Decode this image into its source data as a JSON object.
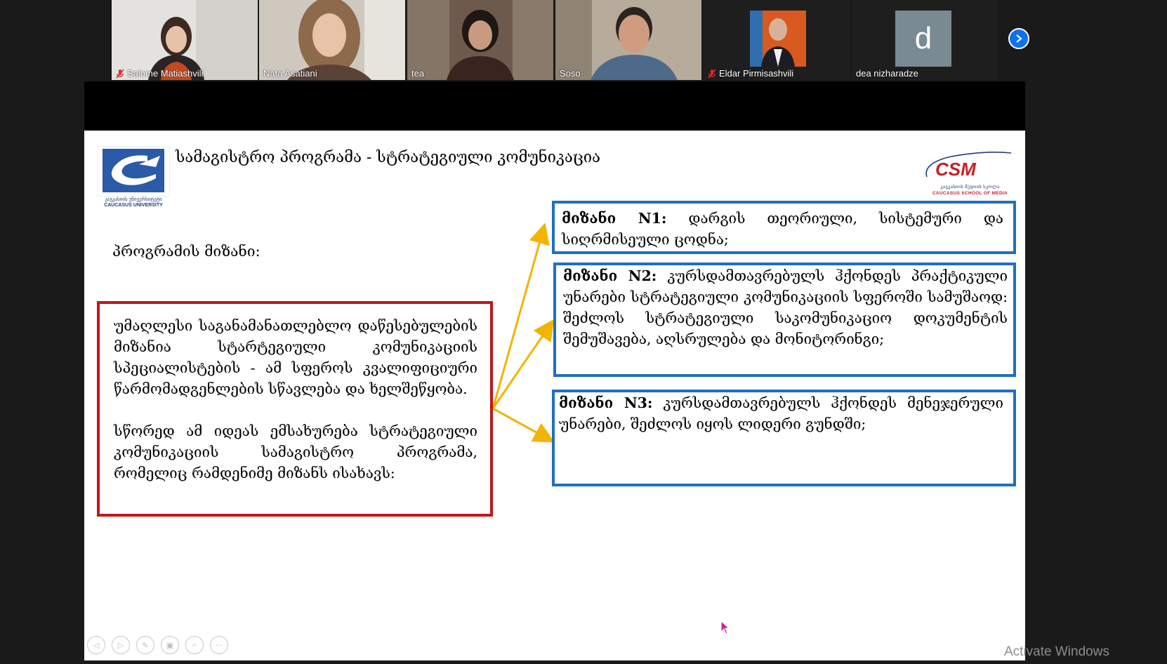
{
  "participants": [
    {
      "name": "Salome Matiashvili",
      "muted": true,
      "bg": "#d9d9d6"
    },
    {
      "name": "Nata Asatiani",
      "muted": false,
      "bg": "#c9c1b7",
      "active_speaker": true
    },
    {
      "name": "tea",
      "muted": false,
      "bg": "#5a4a40"
    },
    {
      "name": "Soso",
      "muted": false,
      "bg": "#a89c8c"
    },
    {
      "name": "Eldar Pirmisashvili",
      "muted": true,
      "bg": "#1e1e1e"
    },
    {
      "name": "dea nizharadze",
      "muted": false,
      "bg": "#1e1e1e",
      "avatar_letter": "d"
    }
  ],
  "next_page_icon": "chevron-right-icon",
  "slide": {
    "title": "სამაგისტრო პროგრამა - სტრატეგიული კომუნიკაცია",
    "cu_logo_text": [
      "კავკასიის უნივერსიტეტი",
      "CAUCASUS UNIVERSITY"
    ],
    "csm_logo": {
      "mark": "CSM",
      "sub1": "კავკასიის მედიის სკოლა",
      "sub2": "CAUCASUS SCHOOL OF MEDIA"
    },
    "goal_label": "პროგრამის მიზანი:",
    "main_box": {
      "p1": "უმაღლესი საგანამანათლებლო დაწესებულების მიზანია სტარტეგიული კომუნიკაციის სპეციალისტების - ამ სფეროს კვალიფიციური წარმომადგენლების სწავლება და ხელშეწყობა.",
      "p2": "სწორედ ამ იდეას ემსახურება სტრატეგიული კომუნიკაციის სამაგისტრო პროგრამა, რომელიც რამდენიმე მიზანს ისახავს:"
    },
    "goals": [
      {
        "label": "მიზანი N1:",
        "text": "დარგის თეორიული, სისტემური და სიღრმისეული ცოდნა;"
      },
      {
        "label": "მიზანი N2:",
        "text": "კურსდამთავრებულს ჰქონდეს პრაქტიკული უნარები სტრატეგიული კომუნიკაციის სფეროში სამუშაოდ: შეძლოს სტრატეგიული საკომუნიკაციო დოკუმენტის შემუშავება, აღსრულება და მონიტორინგი;"
      },
      {
        "label": "მიზანი N3:",
        "text": "კურსდამთავრებულს ჰქონდეს მენეჯერული უნარები, შეძლოს იყოს ლიდერი გუნდში;"
      }
    ],
    "toolbar_icons": [
      "prev-icon",
      "next-icon",
      "pen-icon",
      "slides-icon",
      "zoom-icon",
      "more-icon"
    ]
  },
  "watermark": "Activate Windows",
  "colors": {
    "red_border": "#c0161c",
    "blue_border": "#1f6fc4",
    "arrow": "#f2b400",
    "zoom_blue": "#0e72ed"
  }
}
